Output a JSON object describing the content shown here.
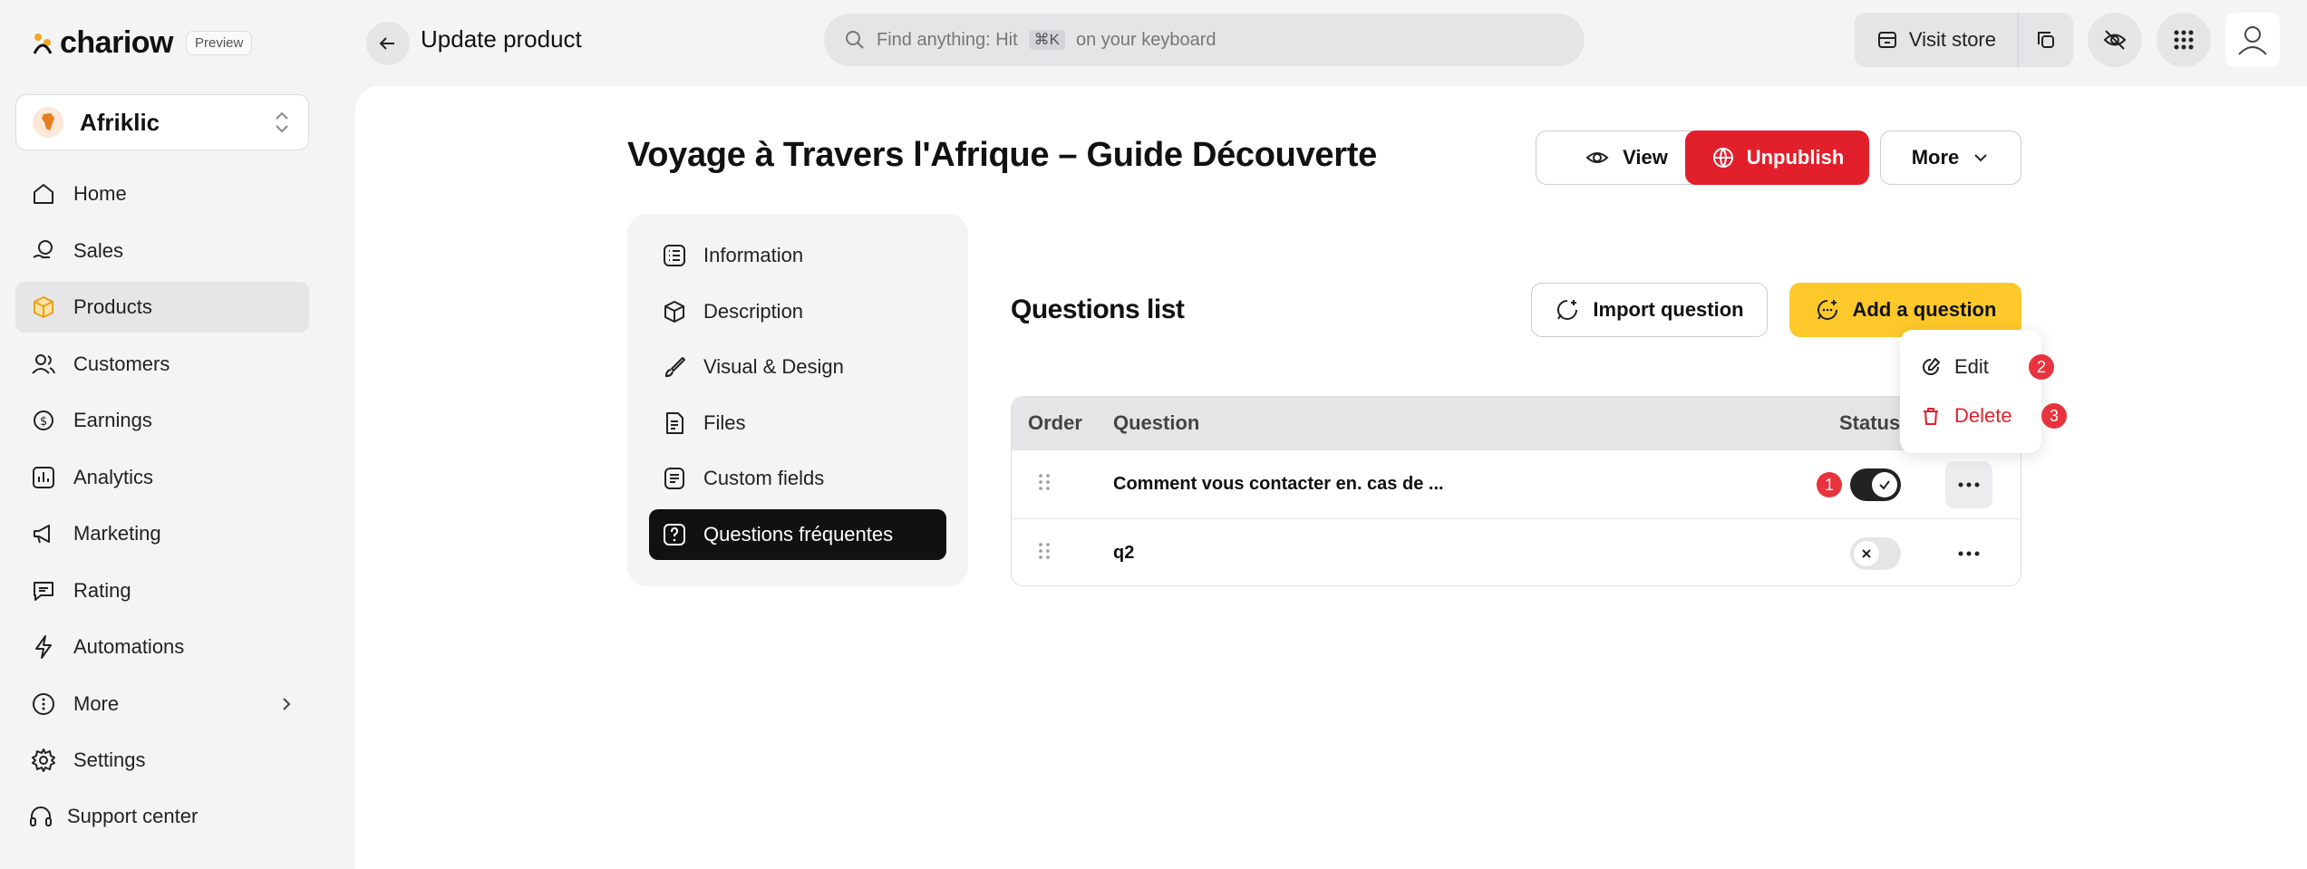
{
  "brand": {
    "name": "chariow",
    "badge": "Preview"
  },
  "store": {
    "name": "Afriklic",
    "avatar_text": "Afriklic"
  },
  "sidebar": {
    "items": [
      {
        "label": "Home",
        "icon": "home-icon"
      },
      {
        "label": "Sales",
        "icon": "sales-icon"
      },
      {
        "label": "Products",
        "icon": "box-icon"
      },
      {
        "label": "Customers",
        "icon": "users-icon"
      },
      {
        "label": "Earnings",
        "icon": "coins-icon"
      },
      {
        "label": "Analytics",
        "icon": "chart-icon"
      },
      {
        "label": "Marketing",
        "icon": "megaphone-icon"
      },
      {
        "label": "Rating",
        "icon": "rating-icon"
      },
      {
        "label": "Automations",
        "icon": "bolt-icon"
      },
      {
        "label": "More",
        "icon": "dots-circle-icon"
      },
      {
        "label": "Settings",
        "icon": "gear-icon"
      }
    ],
    "support": "Support center"
  },
  "header": {
    "title": "Update product",
    "search_placeholder_pre": "Find anything: Hit",
    "search_kbd": "⌘K",
    "search_placeholder_post": "on your keyboard",
    "visit_store": "Visit store"
  },
  "product": {
    "title": "Voyage à Travers l'Afrique – Guide Découverte",
    "view": "View",
    "unpublish": "Unpublish",
    "more": "More"
  },
  "subnav": {
    "items": [
      {
        "label": "Information"
      },
      {
        "label": "Description"
      },
      {
        "label": "Visual & Design"
      },
      {
        "label": "Files"
      },
      {
        "label": "Custom fields"
      },
      {
        "label": "Questions fréquentes"
      }
    ]
  },
  "questions": {
    "title": "Questions list",
    "import": "Import question",
    "add": "Add a question",
    "columns": {
      "order": "Order",
      "question": "Question",
      "status": "Status"
    },
    "rows": [
      {
        "question": "Comment vous contacter en. cas de ...",
        "status": "on",
        "badge": "1"
      },
      {
        "question": "q2",
        "status": "off"
      }
    ]
  },
  "menu": {
    "edit": "Edit",
    "edit_badge": "2",
    "delete": "Delete",
    "delete_badge": "3"
  },
  "colors": {
    "accent_yellow": "#fcc82a",
    "danger_red": "#e2202c",
    "dark": "#111111"
  }
}
